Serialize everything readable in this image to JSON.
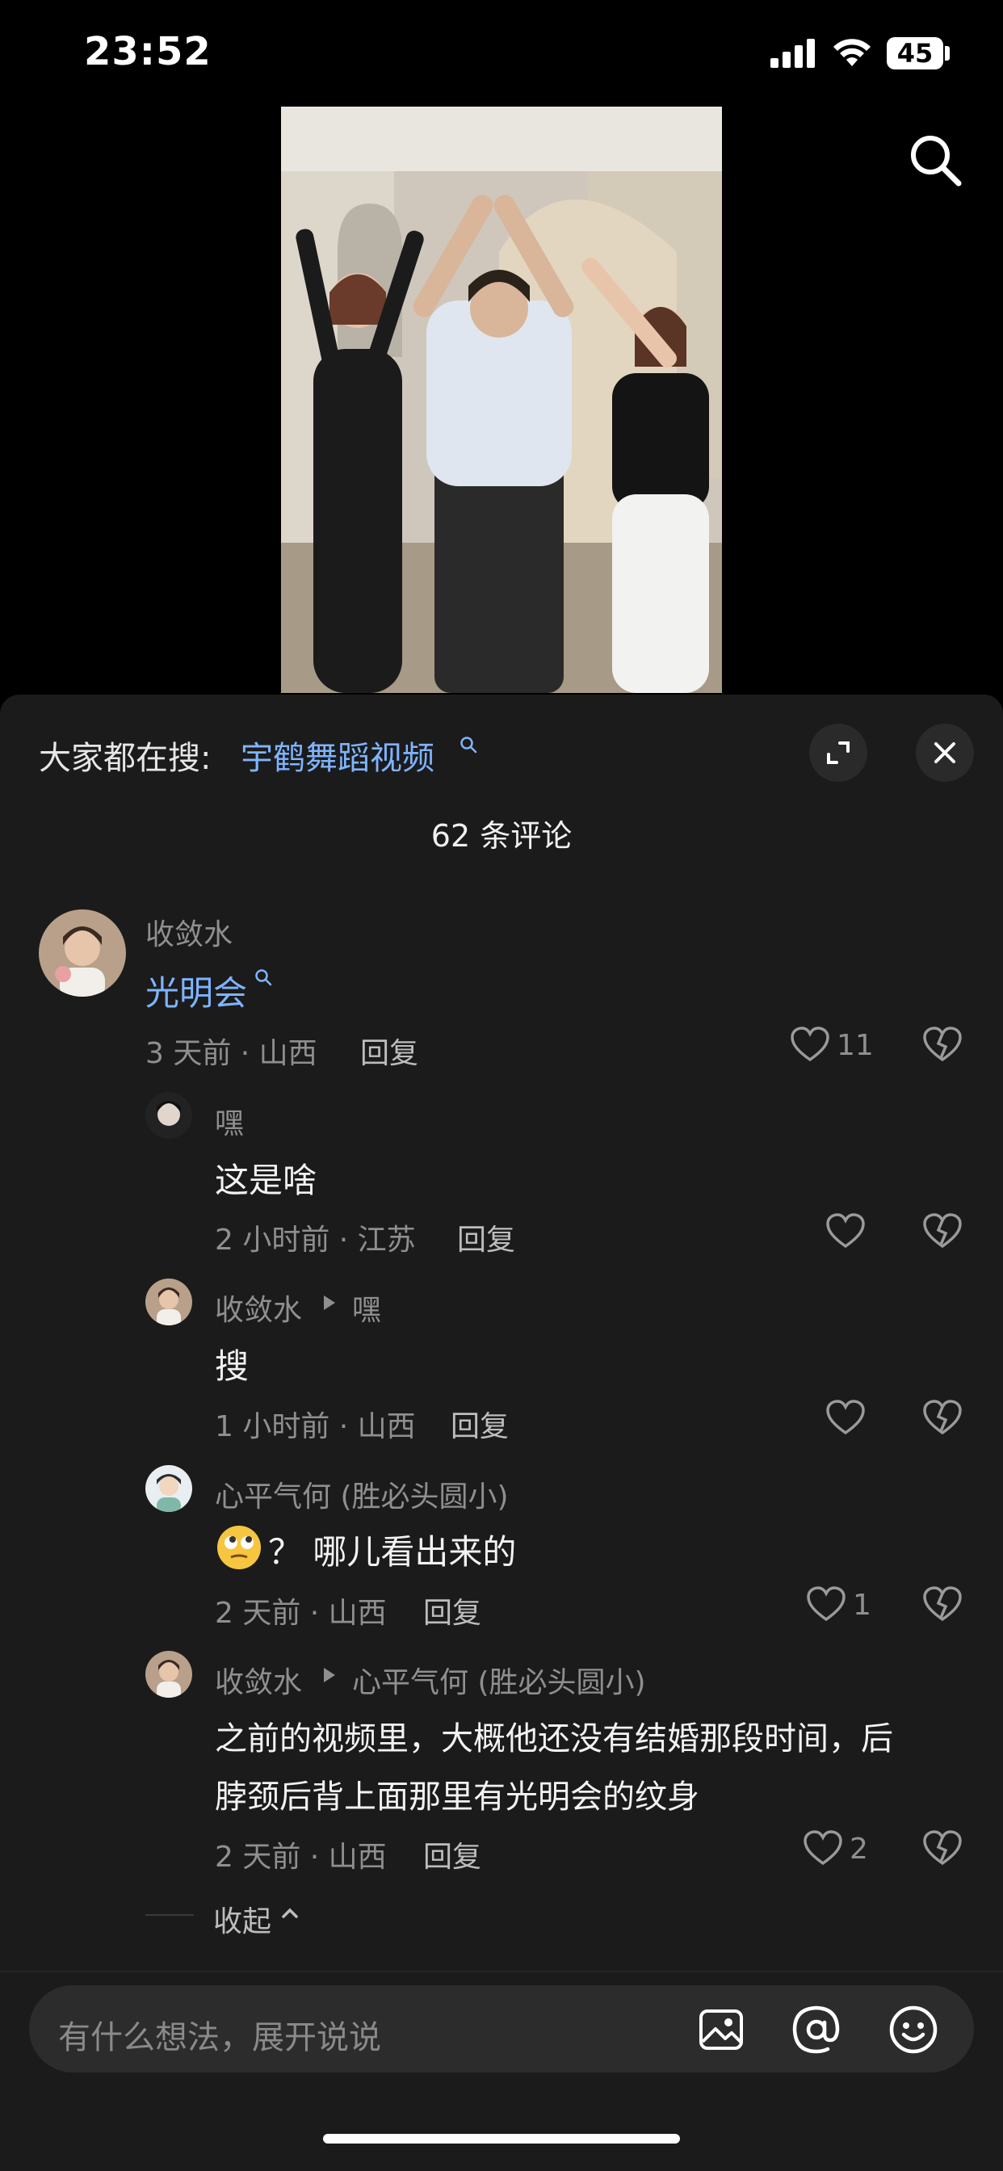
{
  "status_bar": {
    "time": "23:52",
    "battery": "45"
  },
  "search_suggest": {
    "prefix": "大家都在搜:",
    "term": "宇鹤舞蹈视频"
  },
  "comments_title": "62 条评论",
  "comments": [
    {
      "user": "收敛水",
      "text": "光明会",
      "meta": "3 天前 · 山西",
      "reply_label": "回复",
      "likes": "11",
      "replies": [
        {
          "user": "嘿",
          "text": "这是啥",
          "meta": "2 小时前 · 江苏",
          "reply_label": "回复",
          "likes": ""
        },
        {
          "user": "收敛水",
          "reply_to": "嘿",
          "text": "搜",
          "meta": "1 小时前 · 山西",
          "reply_label": "回复",
          "likes": ""
        },
        {
          "user": "心平气何 (胜必头圆小)",
          "text": "？ 哪儿看出来的",
          "meta": "2 天前 · 山西",
          "reply_label": "回复",
          "likes": "1"
        },
        {
          "user": "收敛水",
          "reply_to": "心平气何 (胜必头圆小)",
          "text_line1": "之前的视频里，大概他还没有结婚那段时间，后",
          "text_line2": "脖颈后背上面那里有光明会的纹身",
          "meta": "2 天前 · 山西",
          "reply_label": "回复",
          "likes": "2"
        }
      ],
      "collapse_label": "收起"
    }
  ],
  "input": {
    "placeholder": "有什么想法，展开说说"
  },
  "icons": [
    "search-icon",
    "expand-icon",
    "close-icon",
    "heart-icon",
    "dislike-icon",
    "image-icon",
    "at-icon",
    "emoji-icon",
    "wifi-icon",
    "signal-icon"
  ]
}
